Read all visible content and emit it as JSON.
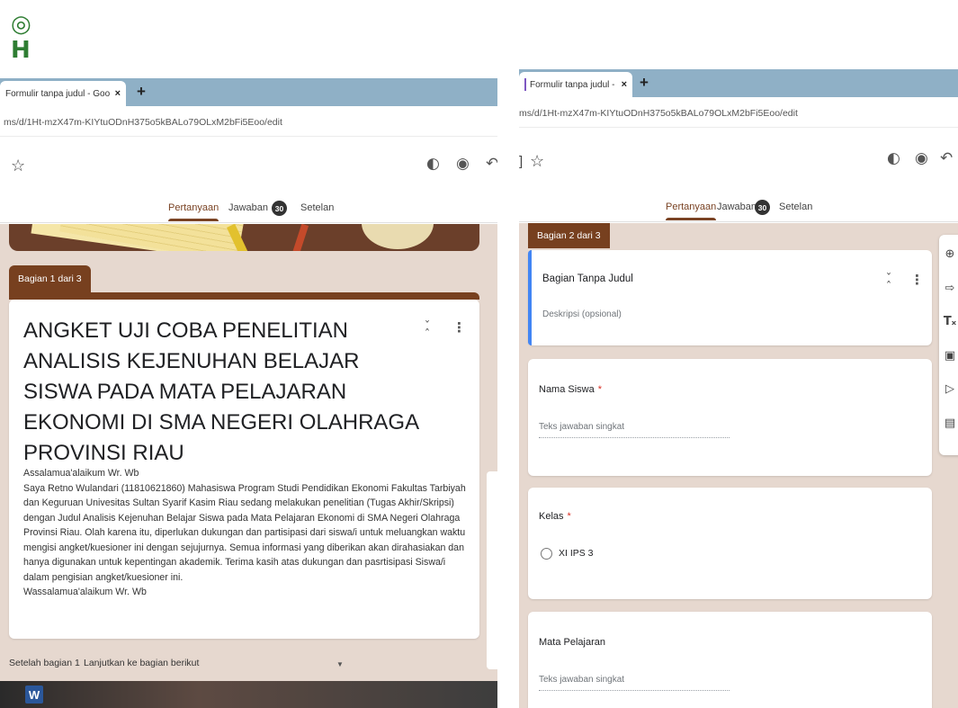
{
  "logo": {
    "glyph1": "◎",
    "glyph2": "H"
  },
  "left_window": {
    "tab_title": "Formulir tanpa judul - Google Fo",
    "close": "×",
    "new_tab": "+",
    "url": "ms/d/1Ht-mzX47m-KIYtuODnH375o5kBALo79OLxM2bFi5Eoo/edit",
    "star": "☆",
    "toolbar_icons": [
      "palette-icon",
      "preview-icon",
      "undo-icon"
    ],
    "tabs": {
      "questions": "Pertanyaan",
      "responses": "Jawaban",
      "response_count": "30",
      "settings": "Setelan"
    },
    "section_tag": "Bagian 1 dari 3",
    "form_title": "ANGKET UJI COBA PENELITIAN ANALISIS KEJENUHAN BELAJAR SISWA PADA MATA PELAJARAN EKONOMI DI SMA NEGERI OLAHRAGA PROVINSI RIAU",
    "description": {
      "greeting": "Assalamua'alaikum Wr. Wb",
      "body": "Saya Retno Wulandari (11810621860) Mahasiswa Program Studi Pendidikan Ekonomi Fakultas Tarbiyah dan Keguruan Univesitas Sultan Syarif Kasim Riau sedang melakukan penelitian (Tugas Akhir/Skripsi) dengan Judul Analisis Kejenuhan Belajar Siswa pada Mata Pelajaran Ekonomi di SMA Negeri Olahraga Provinsi Riau. Olah karena itu, diperlukan dukungan dan partisipasi dari siswa/i untuk meluangkan waktu mengisi angket/kuesioner ini dengan sejujurnya. Semua informasi yang diberikan akan dirahasiakan dan hanya digunakan untuk kepentingan akademik. Terima kasih atas dukungan dan pasrtisipasi Siswa/i dalam pengisian angket/kuesioner ini.",
      "closing": "Wassalamua'alaikum Wr. Wb"
    },
    "after_section_label": "Setelah bagian 1",
    "after_section_value": "Lanjutkan ke bagian berikut",
    "taskbar_app": "W"
  },
  "right_window": {
    "tab_title": "Formulir tanpa judul - Google Fo",
    "close": "×",
    "new_tab": "+",
    "url": "ms/d/1Ht-mzX47m-KIYtuODnH375o5kBALo79OLxM2bFi5Eoo/edit",
    "bracket": "]",
    "star": "☆",
    "tabs": {
      "questions": "Pertanyaan",
      "responses": "Jawaban",
      "response_count": "30",
      "settings": "Setelan"
    },
    "section_tag": "Bagian 2 dari 3",
    "section_title": "Bagian Tanpa Judul",
    "section_desc": "Deskripsi (opsional)",
    "questions": [
      {
        "title": "Nama Siswa",
        "required": "*",
        "placeholder": "Teks jawaban singkat"
      },
      {
        "title": "Kelas",
        "required": "*",
        "option": "XI IPS 3"
      },
      {
        "title": "Mata Pelajaran",
        "placeholder": "Teks jawaban singkat"
      }
    ],
    "side_tools": [
      "add-question-icon",
      "import-questions-icon",
      "add-title-icon",
      "add-image-icon",
      "add-video-icon",
      "add-section-icon"
    ]
  }
}
